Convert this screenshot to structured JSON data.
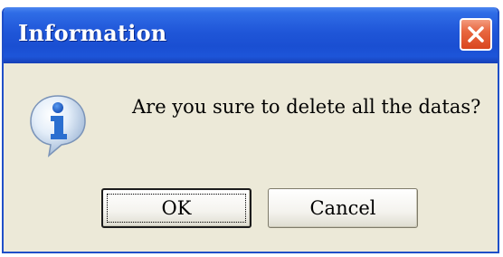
{
  "dialog": {
    "title": "Information",
    "message": "Are you sure to delete all the datas?",
    "icon": "info-icon",
    "close_icon": "close-icon",
    "buttons": {
      "ok_label": "OK",
      "cancel_label": "Cancel"
    }
  },
  "colors": {
    "titlebar": "#1f56d8",
    "body": "#ece9d8",
    "close_button": "#e8663f",
    "info_icon": "#2b6fd0"
  }
}
